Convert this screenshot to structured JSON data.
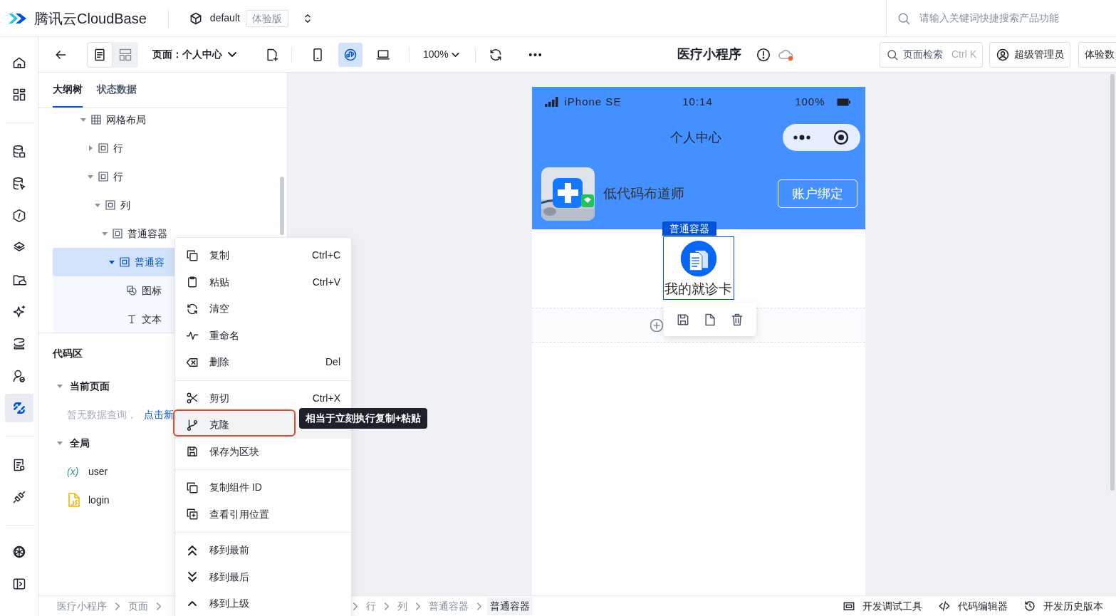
{
  "header": {
    "brand": "腾讯云CloudBase",
    "env": "default",
    "env_badge": "体验版",
    "search": {
      "placeholder": "请输入关键词快捷搜索产品功能"
    }
  },
  "rail": [
    [
      {
        "selected": false
      },
      {
        "selected": false
      }
    ],
    [
      {
        "selected": false
      },
      {
        "selected": false
      },
      {
        "selected": false
      },
      {
        "selected": false
      },
      {
        "selected": false
      },
      {
        "selected": false
      },
      {
        "selected": false
      },
      {
        "selected": false
      },
      {
        "selected": true
      }
    ],
    [
      {
        "selected": false
      },
      {
        "selected": false
      }
    ],
    [
      {
        "selected": false
      },
      {
        "selected": false
      }
    ]
  ],
  "toolbar": {
    "views": [
      {
        "selected": true
      },
      {
        "selected": false
      }
    ],
    "page": "页面：个人中心",
    "devices": [
      {
        "selected": false
      },
      {
        "selected": true
      },
      {
        "selected": false
      }
    ],
    "zoom": "100%",
    "app_title": "医疗小程序",
    "page_search": {
      "label": "页面检索",
      "shortcut": "Ctrl K"
    },
    "user": "超级管理员",
    "trial": "体验数"
  },
  "panel": {
    "tabs": [
      {
        "label": "大纲树",
        "selected": true
      },
      {
        "label": "状态数据",
        "selected": false
      }
    ],
    "tree": [
      {
        "kind": "grid",
        "label": "网格布局",
        "expanded": true,
        "selected": false,
        "children": [
          {
            "kind": "container",
            "label": "行",
            "expanded": false,
            "selected": false
          },
          {
            "kind": "container",
            "label": "行",
            "expanded": true,
            "selected": false,
            "children": [
              {
                "kind": "container",
                "label": "列",
                "expanded": true,
                "selected": false,
                "children": [
                  {
                    "kind": "container",
                    "label": "普通容器",
                    "expanded": true,
                    "selected": false,
                    "children": [
                      {
                        "kind": "container",
                        "label": "普通容",
                        "expanded": true,
                        "selected": true,
                        "children": [
                          {
                            "kind": "icon",
                            "label": "图标",
                            "selected": false
                          },
                          {
                            "kind": "text",
                            "label": "文本",
                            "selected": false
                          }
                        ]
                      }
                    ]
                  }
                ]
              }
            ]
          }
        ]
      }
    ],
    "code": {
      "title": "代码区",
      "sections": [
        {
          "title": "当前页面",
          "expanded": true,
          "empty_text": "暂无数据查询，",
          "empty_link": "点击新"
        },
        {
          "title": "全局",
          "expanded": true,
          "items": [
            {
              "kind": "variable",
              "badge": "(x)",
              "label": "user"
            },
            {
              "kind": "script",
              "label": "login"
            }
          ]
        }
      ]
    }
  },
  "phone": {
    "carrier": "iPhone SE",
    "time": "10:14",
    "battery": "100%",
    "title": "个人中心",
    "user_name": "低代码布道师",
    "bind_button": "账户绑定",
    "selected_tag": "普通容器",
    "card_label": "我的就诊卡"
  },
  "status_bar": {
    "breadcrumb_start": [
      {
        "label": "医疗小程序",
        "selected": false
      },
      {
        "label": "页面",
        "selected": false
      }
    ],
    "breadcrumb_end": [
      {
        "label": "行",
        "selected": false
      },
      {
        "label": "列",
        "selected": false
      },
      {
        "label": "普通容器",
        "selected": false
      },
      {
        "label": "普通容器",
        "selected": true
      }
    ],
    "tools": [
      "开发调试工具",
      "代码编辑器",
      "开发历史版本"
    ]
  },
  "context_menu": {
    "groups": [
      [
        {
          "label": "复制",
          "shortcut": "Ctrl+C",
          "selected": false,
          "annotated": false
        },
        {
          "label": "粘贴",
          "shortcut": "Ctrl+V",
          "selected": false,
          "annotated": false
        },
        {
          "label": "清空",
          "selected": false,
          "annotated": false
        },
        {
          "label": "重命名",
          "selected": false,
          "annotated": false
        },
        {
          "label": "删除",
          "shortcut": "Del",
          "selected": false,
          "annotated": false
        }
      ],
      [
        {
          "label": "剪切",
          "shortcut": "Ctrl+X",
          "selected": false,
          "annotated": false
        },
        {
          "label": "克隆",
          "selected": true,
          "annotated": true
        },
        {
          "label": "保存为区块",
          "selected": false,
          "annotated": false
        }
      ],
      [
        {
          "label": "复制组件 ID",
          "selected": false,
          "annotated": false
        },
        {
          "label": "查看引用位置",
          "selected": false,
          "annotated": false
        }
      ],
      [
        {
          "label": "移到最前",
          "selected": false,
          "annotated": false
        },
        {
          "label": "移到最后",
          "selected": false,
          "annotated": false
        },
        {
          "label": "移到上级",
          "selected": false,
          "annotated": false
        }
      ]
    ]
  },
  "tooltip": "相当于立刻执行复制+粘贴"
}
